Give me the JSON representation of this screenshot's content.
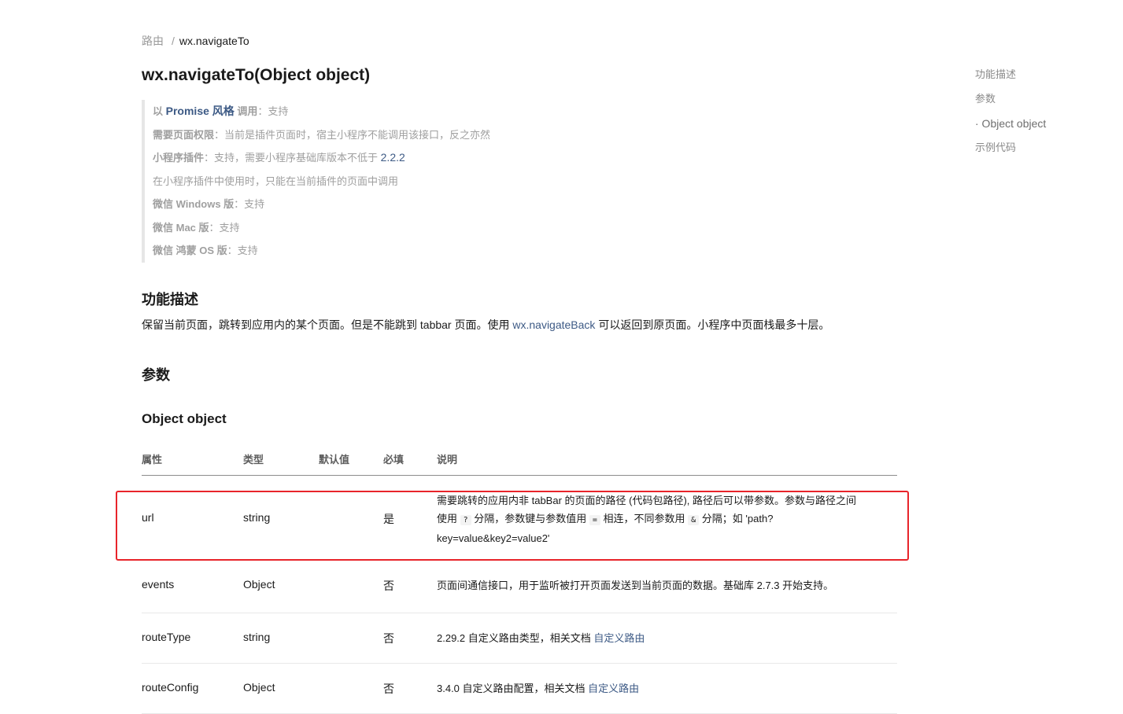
{
  "breadcrumb": {
    "parent": "路由",
    "separator": "/",
    "current": "wx.navigateTo"
  },
  "page_title": "wx.navigateTo(Object object)",
  "support": {
    "promise": {
      "prefix": "以",
      "link": "Promise 风格",
      "label": "调用",
      "value": "：支持"
    },
    "page_permission": {
      "label": "需要页面权限",
      "value": "：当前是插件页面时，宿主小程序不能调用该接口，反之亦然"
    },
    "plugin": {
      "label": "小程序插件",
      "value": "：支持，需要小程序基础库版本不低于 ",
      "version_link": "2.2.2"
    },
    "plugin_note": "在小程序插件中使用时，只能在当前插件的页面中调用",
    "windows": {
      "label": "微信 Windows 版",
      "value": "：支持"
    },
    "mac": {
      "label": "微信 Mac 版",
      "value": "：支持"
    },
    "harmony": {
      "label": "微信 鸿蒙 OS 版",
      "value": "：支持"
    }
  },
  "section_desc": {
    "title": "功能描述",
    "text_before": "保留当前页面，跳转到应用内的某个页面。但是不能跳到 tabbar 页面。使用 ",
    "link": "wx.navigateBack",
    "text_after": " 可以返回到原页面。小程序中页面栈最多十层。"
  },
  "section_params": {
    "title": "参数"
  },
  "object_heading": "Object object",
  "table": {
    "headers": [
      "属性",
      "类型",
      "默认值",
      "必填",
      "说明"
    ],
    "rows": [
      {
        "name": "url",
        "type": "string",
        "default": "",
        "required": "是",
        "desc": {
          "line1": "需要跳转的应用内非 tabBar 的页面的路径 (代码包路径), 路径后可以带参数。参数与路径之间",
          "p1": "使用 ",
          "code1": "?",
          "p2": " 分隔，参数键与参数值用 ",
          "code2": "=",
          "p3": " 相连，不同参数用 ",
          "code3": "&",
          "p4": " 分隔；如 'path?",
          "line3": "key=value&key2=value2'"
        }
      },
      {
        "name": "events",
        "type": "Object",
        "default": "",
        "required": "否",
        "desc": {
          "text": "页面间通信接口，用于监听被打开页面发送到当前页面的数据。基础库 2.7.3 开始支持。"
        }
      },
      {
        "name": "routeType",
        "type": "string",
        "default": "",
        "required": "否",
        "desc": {
          "text": "2.29.2 自定义路由类型，相关文档 ",
          "link": "自定义路由"
        }
      },
      {
        "name": "routeConfig",
        "type": "Object",
        "default": "",
        "required": "否",
        "desc": {
          "text": "3.4.0 自定义路由配置，相关文档 ",
          "link": "自定义路由"
        }
      }
    ]
  },
  "toc": {
    "items": [
      "功能描述",
      "参数",
      "· Object object",
      "示例代码"
    ]
  },
  "colors": {
    "link": "#3d5a85",
    "highlight_border": "#e8242a",
    "muted_text": "#9f9f9f"
  }
}
